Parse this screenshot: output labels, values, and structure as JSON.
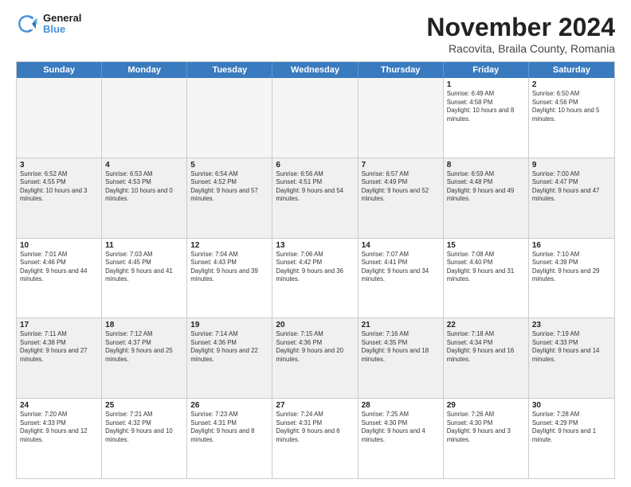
{
  "header": {
    "logo_line1": "General",
    "logo_line2": "Blue",
    "main_title": "November 2024",
    "subtitle": "Racovita, Braila County, Romania"
  },
  "days_of_week": [
    "Sunday",
    "Monday",
    "Tuesday",
    "Wednesday",
    "Thursday",
    "Friday",
    "Saturday"
  ],
  "weeks": [
    [
      {
        "day": "",
        "info": "",
        "empty": true
      },
      {
        "day": "",
        "info": "",
        "empty": true
      },
      {
        "day": "",
        "info": "",
        "empty": true
      },
      {
        "day": "",
        "info": "",
        "empty": true
      },
      {
        "day": "",
        "info": "",
        "empty": true
      },
      {
        "day": "1",
        "info": "Sunrise: 6:49 AM\nSunset: 4:58 PM\nDaylight: 10 hours and 8 minutes.",
        "empty": false
      },
      {
        "day": "2",
        "info": "Sunrise: 6:50 AM\nSunset: 4:56 PM\nDaylight: 10 hours and 5 minutes.",
        "empty": false
      }
    ],
    [
      {
        "day": "3",
        "info": "Sunrise: 6:52 AM\nSunset: 4:55 PM\nDaylight: 10 hours and 3 minutes.",
        "empty": false
      },
      {
        "day": "4",
        "info": "Sunrise: 6:53 AM\nSunset: 4:53 PM\nDaylight: 10 hours and 0 minutes.",
        "empty": false
      },
      {
        "day": "5",
        "info": "Sunrise: 6:54 AM\nSunset: 4:52 PM\nDaylight: 9 hours and 57 minutes.",
        "empty": false
      },
      {
        "day": "6",
        "info": "Sunrise: 6:56 AM\nSunset: 4:51 PM\nDaylight: 9 hours and 54 minutes.",
        "empty": false
      },
      {
        "day": "7",
        "info": "Sunrise: 6:57 AM\nSunset: 4:49 PM\nDaylight: 9 hours and 52 minutes.",
        "empty": false
      },
      {
        "day": "8",
        "info": "Sunrise: 6:59 AM\nSunset: 4:48 PM\nDaylight: 9 hours and 49 minutes.",
        "empty": false
      },
      {
        "day": "9",
        "info": "Sunrise: 7:00 AM\nSunset: 4:47 PM\nDaylight: 9 hours and 47 minutes.",
        "empty": false
      }
    ],
    [
      {
        "day": "10",
        "info": "Sunrise: 7:01 AM\nSunset: 4:46 PM\nDaylight: 9 hours and 44 minutes.",
        "empty": false
      },
      {
        "day": "11",
        "info": "Sunrise: 7:03 AM\nSunset: 4:45 PM\nDaylight: 9 hours and 41 minutes.",
        "empty": false
      },
      {
        "day": "12",
        "info": "Sunrise: 7:04 AM\nSunset: 4:43 PM\nDaylight: 9 hours and 39 minutes.",
        "empty": false
      },
      {
        "day": "13",
        "info": "Sunrise: 7:06 AM\nSunset: 4:42 PM\nDaylight: 9 hours and 36 minutes.",
        "empty": false
      },
      {
        "day": "14",
        "info": "Sunrise: 7:07 AM\nSunset: 4:41 PM\nDaylight: 9 hours and 34 minutes.",
        "empty": false
      },
      {
        "day": "15",
        "info": "Sunrise: 7:08 AM\nSunset: 4:40 PM\nDaylight: 9 hours and 31 minutes.",
        "empty": false
      },
      {
        "day": "16",
        "info": "Sunrise: 7:10 AM\nSunset: 4:39 PM\nDaylight: 9 hours and 29 minutes.",
        "empty": false
      }
    ],
    [
      {
        "day": "17",
        "info": "Sunrise: 7:11 AM\nSunset: 4:38 PM\nDaylight: 9 hours and 27 minutes.",
        "empty": false
      },
      {
        "day": "18",
        "info": "Sunrise: 7:12 AM\nSunset: 4:37 PM\nDaylight: 9 hours and 25 minutes.",
        "empty": false
      },
      {
        "day": "19",
        "info": "Sunrise: 7:14 AM\nSunset: 4:36 PM\nDaylight: 9 hours and 22 minutes.",
        "empty": false
      },
      {
        "day": "20",
        "info": "Sunrise: 7:15 AM\nSunset: 4:36 PM\nDaylight: 9 hours and 20 minutes.",
        "empty": false
      },
      {
        "day": "21",
        "info": "Sunrise: 7:16 AM\nSunset: 4:35 PM\nDaylight: 9 hours and 18 minutes.",
        "empty": false
      },
      {
        "day": "22",
        "info": "Sunrise: 7:18 AM\nSunset: 4:34 PM\nDaylight: 9 hours and 16 minutes.",
        "empty": false
      },
      {
        "day": "23",
        "info": "Sunrise: 7:19 AM\nSunset: 4:33 PM\nDaylight: 9 hours and 14 minutes.",
        "empty": false
      }
    ],
    [
      {
        "day": "24",
        "info": "Sunrise: 7:20 AM\nSunset: 4:33 PM\nDaylight: 9 hours and 12 minutes.",
        "empty": false
      },
      {
        "day": "25",
        "info": "Sunrise: 7:21 AM\nSunset: 4:32 PM\nDaylight: 9 hours and 10 minutes.",
        "empty": false
      },
      {
        "day": "26",
        "info": "Sunrise: 7:23 AM\nSunset: 4:31 PM\nDaylight: 9 hours and 8 minutes.",
        "empty": false
      },
      {
        "day": "27",
        "info": "Sunrise: 7:24 AM\nSunset: 4:31 PM\nDaylight: 9 hours and 6 minutes.",
        "empty": false
      },
      {
        "day": "28",
        "info": "Sunrise: 7:25 AM\nSunset: 4:30 PM\nDaylight: 9 hours and 4 minutes.",
        "empty": false
      },
      {
        "day": "29",
        "info": "Sunrise: 7:26 AM\nSunset: 4:30 PM\nDaylight: 9 hours and 3 minutes.",
        "empty": false
      },
      {
        "day": "30",
        "info": "Sunrise: 7:28 AM\nSunset: 4:29 PM\nDaylight: 9 hours and 1 minute.",
        "empty": false
      }
    ]
  ]
}
